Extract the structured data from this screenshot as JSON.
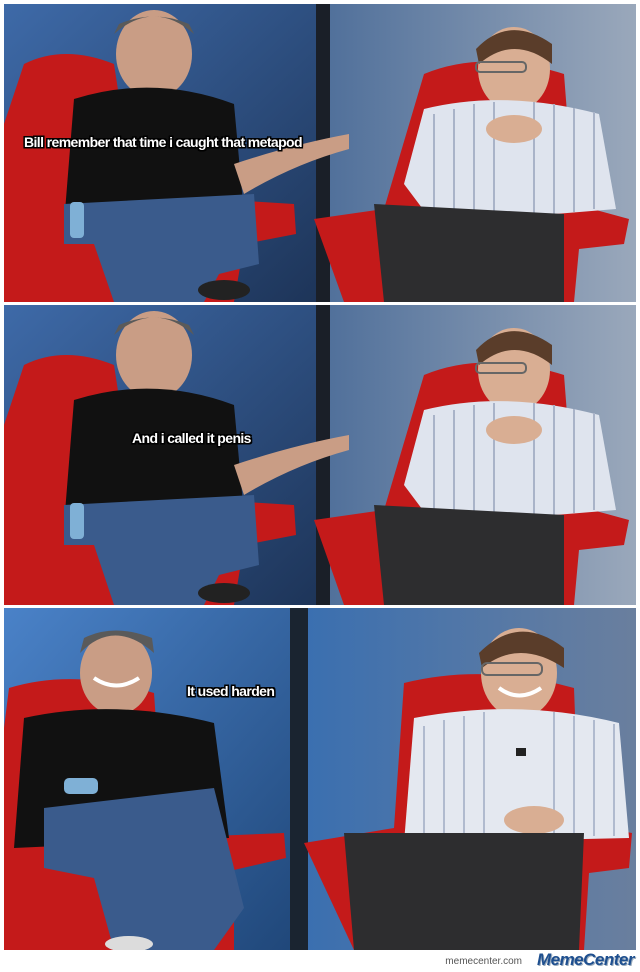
{
  "panels": [
    {
      "caption": "Bill remember that time i caught that metapod"
    },
    {
      "caption": "And i called it penis"
    },
    {
      "caption": "It used harden"
    }
  ],
  "footer": {
    "url": "memecenter.com",
    "logo": "MemeCenter"
  },
  "colors": {
    "backdrop_blue": "#2f5f9a",
    "chair_red": "#c41a1a",
    "black_turtleneck": "#111111",
    "striped_shirt": "#dfe4ee",
    "jeans": "#3a5b8c"
  }
}
